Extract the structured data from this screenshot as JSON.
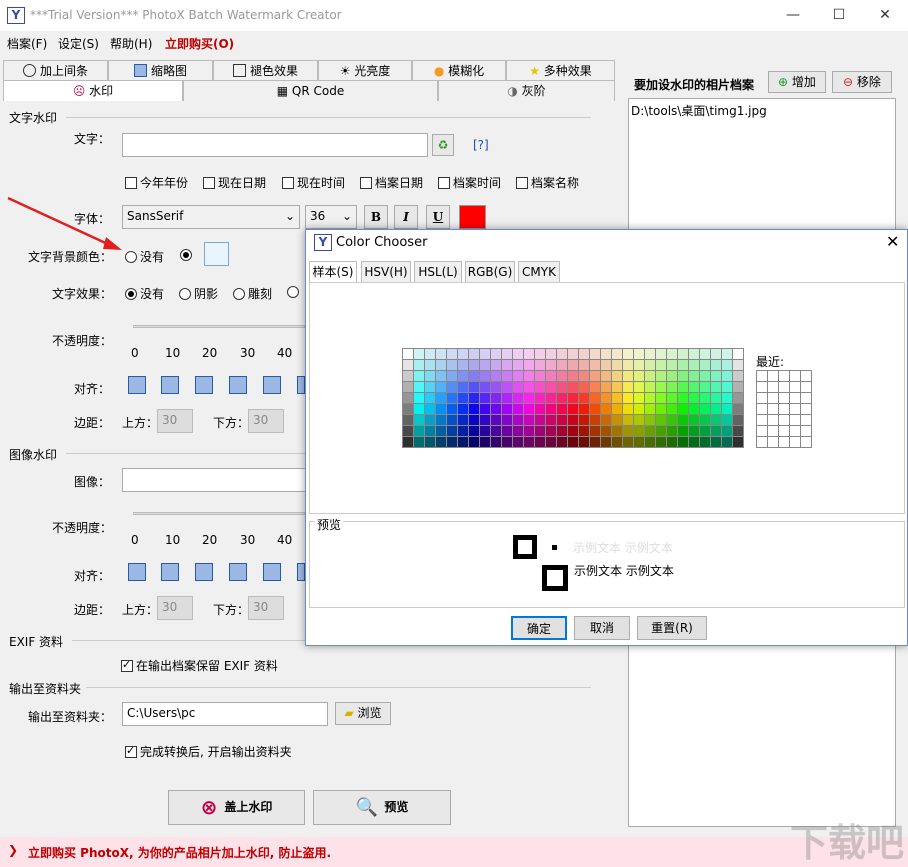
{
  "app": {
    "title": "***Trial Version*** PhotoX Batch Watermark Creator",
    "icon_letter": "Y"
  },
  "menu": [
    "档案(F)",
    "设定(S)",
    "帮助(H)",
    "立即购买(O)"
  ],
  "tabs_row1": [
    "加上间条",
    "缩略图",
    "褪色效果",
    "光亮度",
    "模糊化",
    "多种效果"
  ],
  "tabs_row2": [
    "水印",
    "QR Code",
    "灰阶"
  ],
  "text_watermark": {
    "section": "文字水印",
    "text_label": "文字：",
    "text_value": "",
    "help": "[?]",
    "checkboxes": [
      "今年年份",
      "现在日期",
      "现在时间",
      "档案日期",
      "档案时间",
      "档案名称"
    ],
    "font_label": "字体：",
    "font_value": "SansSerif",
    "size_value": "36",
    "bold": "B",
    "italic": "I",
    "underline": "U",
    "font_color": "#ff0000",
    "bg_label": "文字背景颜色：",
    "bg_none": "没有",
    "effect_label": "文字效果：",
    "effects": [
      "没有",
      "阴影",
      "雕刻"
    ],
    "opacity_label": "不透明度：",
    "ticks": [
      "0",
      "10",
      "20",
      "30",
      "40"
    ],
    "align_label": "对齐：",
    "margin_label": "边距：",
    "top_label": "上方：",
    "top_value": "30",
    "bottom_label": "下方：",
    "bottom_value": "30"
  },
  "image_watermark": {
    "section": "图像水印",
    "image_label": "图像：",
    "image_value": "",
    "opacity_label": "不透明度：",
    "ticks": [
      "0",
      "10",
      "20",
      "30",
      "40"
    ],
    "align_label": "对齐：",
    "margin_label": "边距：",
    "top_label": "上方：",
    "top_value": "30",
    "bottom_label": "下方：",
    "bottom_value": "30"
  },
  "exif": {
    "section": "EXIF 资料",
    "keep_label": "在输出档案保留 EXIF 资料"
  },
  "output": {
    "section": "输出至资料夹",
    "folder_label": "输出至资料夹：",
    "folder_value": "C:\\Users\\pc",
    "browse": "浏览",
    "open_after": "完成转换后, 开启输出资料夹"
  },
  "actions": {
    "apply": "盖上水印",
    "preview": "预览"
  },
  "right": {
    "heading": "要加设水印的相片档案",
    "add": "增加",
    "remove": "移除",
    "files": [
      "D:\\tools\\桌面\\timg1.jpg"
    ]
  },
  "bottom_banner": "立即购买 PhotoX, 为你的产品相片加上水印, 防止盗用.",
  "dialog": {
    "title": "Color Chooser",
    "tabs": [
      "样本(S)",
      "HSV(H)",
      "HSL(L)",
      "RGB(G)",
      "CMYK"
    ],
    "recent_label": "最近:",
    "preview_label": "预览",
    "sample_text": "示例文本",
    "ok": "确定",
    "cancel": "取消",
    "reset": "重置(R)"
  }
}
